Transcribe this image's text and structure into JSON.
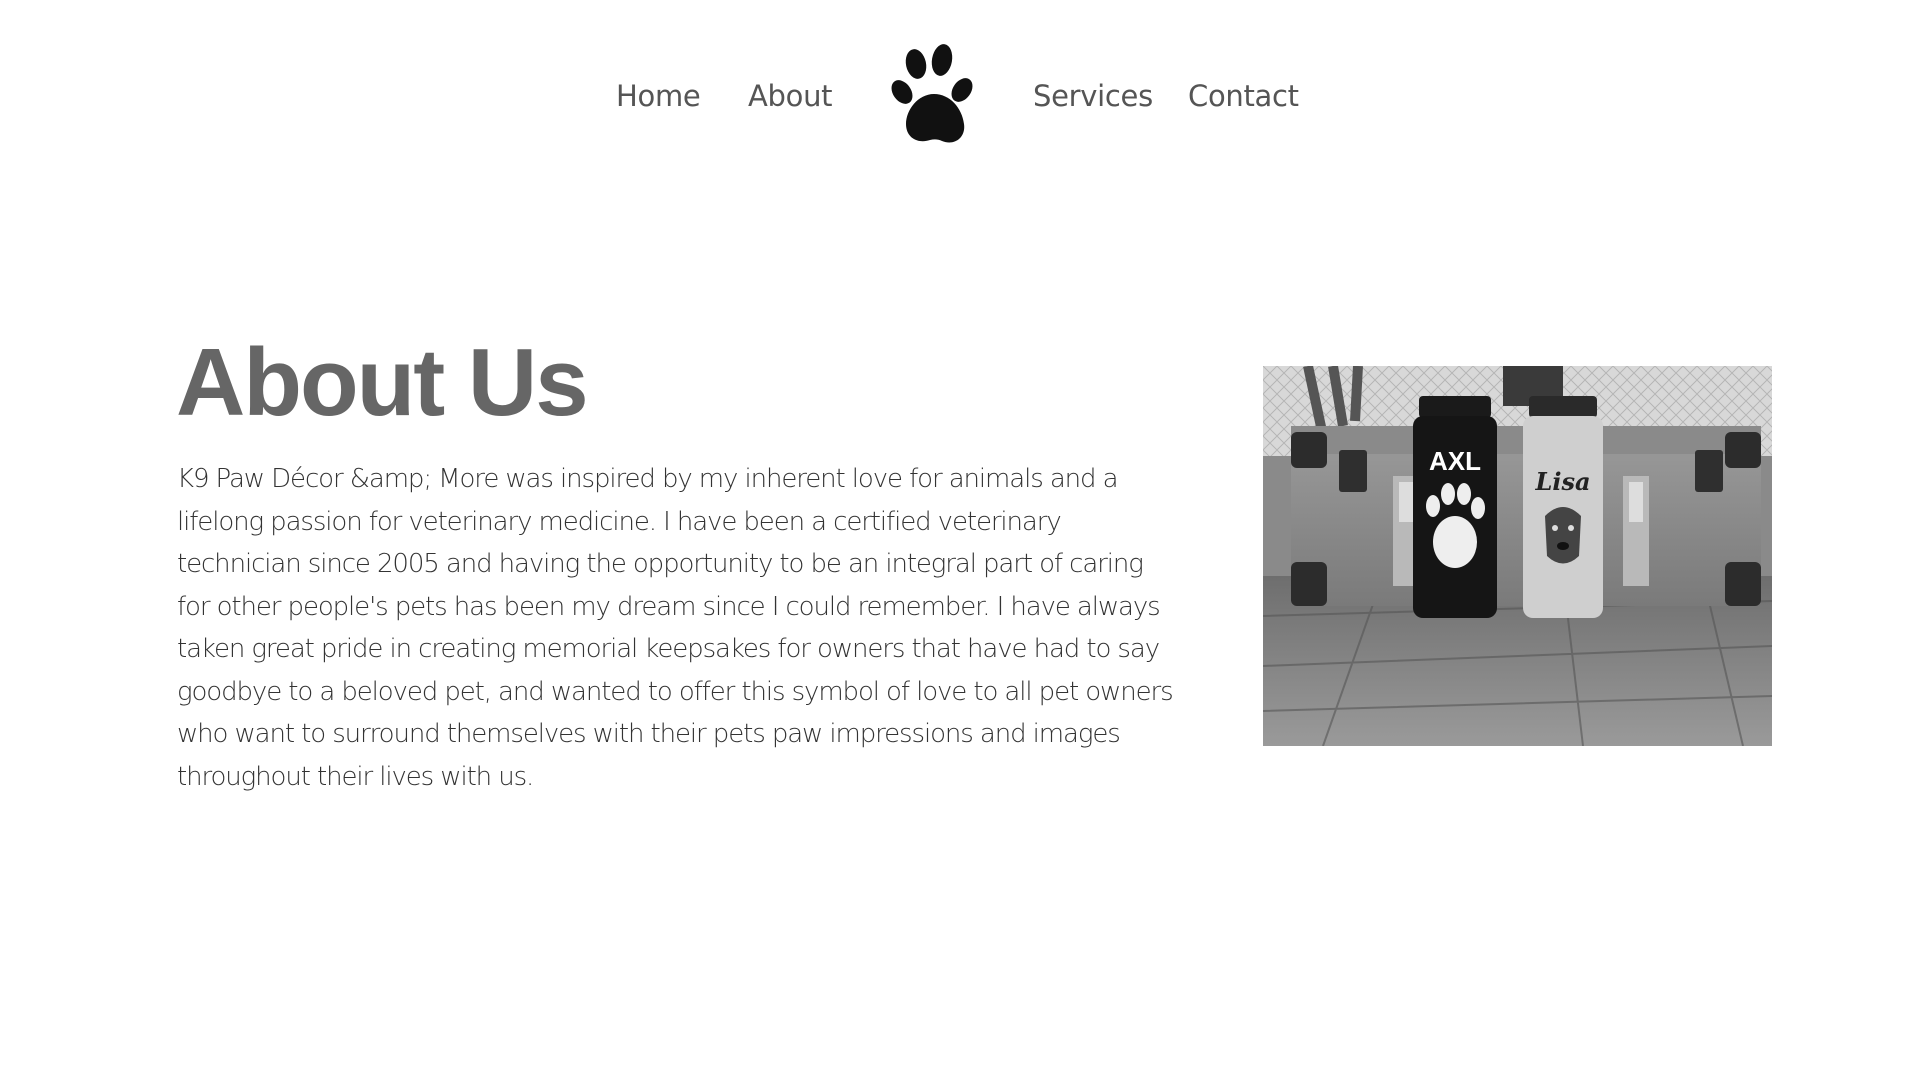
{
  "nav": {
    "home_label": "Home",
    "about_label": "About",
    "services_label": "Services",
    "contact_label": "Contact",
    "logo_icon": "paw-print-icon"
  },
  "about": {
    "title": "About Us",
    "body": "K9 Paw Décor &amp; More was inspired by my inherent love for animals and a lifelong passion for veterinary medicine. I have been a certified veterinary technician since 2005 and having the opportunity to be an integral part of caring for other people's pets has been my dream since I could remember. I have always taken great pride in creating memorial keepsakes for owners that have had to say goodbye to a beloved pet, and wanted to offer this symbol of love to all pet owners who want to surround themselves with their pets paw impressions and images throughout their lives with us."
  },
  "photo": {
    "bottle_left_text": "AXL",
    "bottle_right_text": "Lisa"
  },
  "colors": {
    "nav_text": "#555555",
    "title_text": "#666666",
    "body_text": "#333333",
    "background": "#ffffff"
  }
}
